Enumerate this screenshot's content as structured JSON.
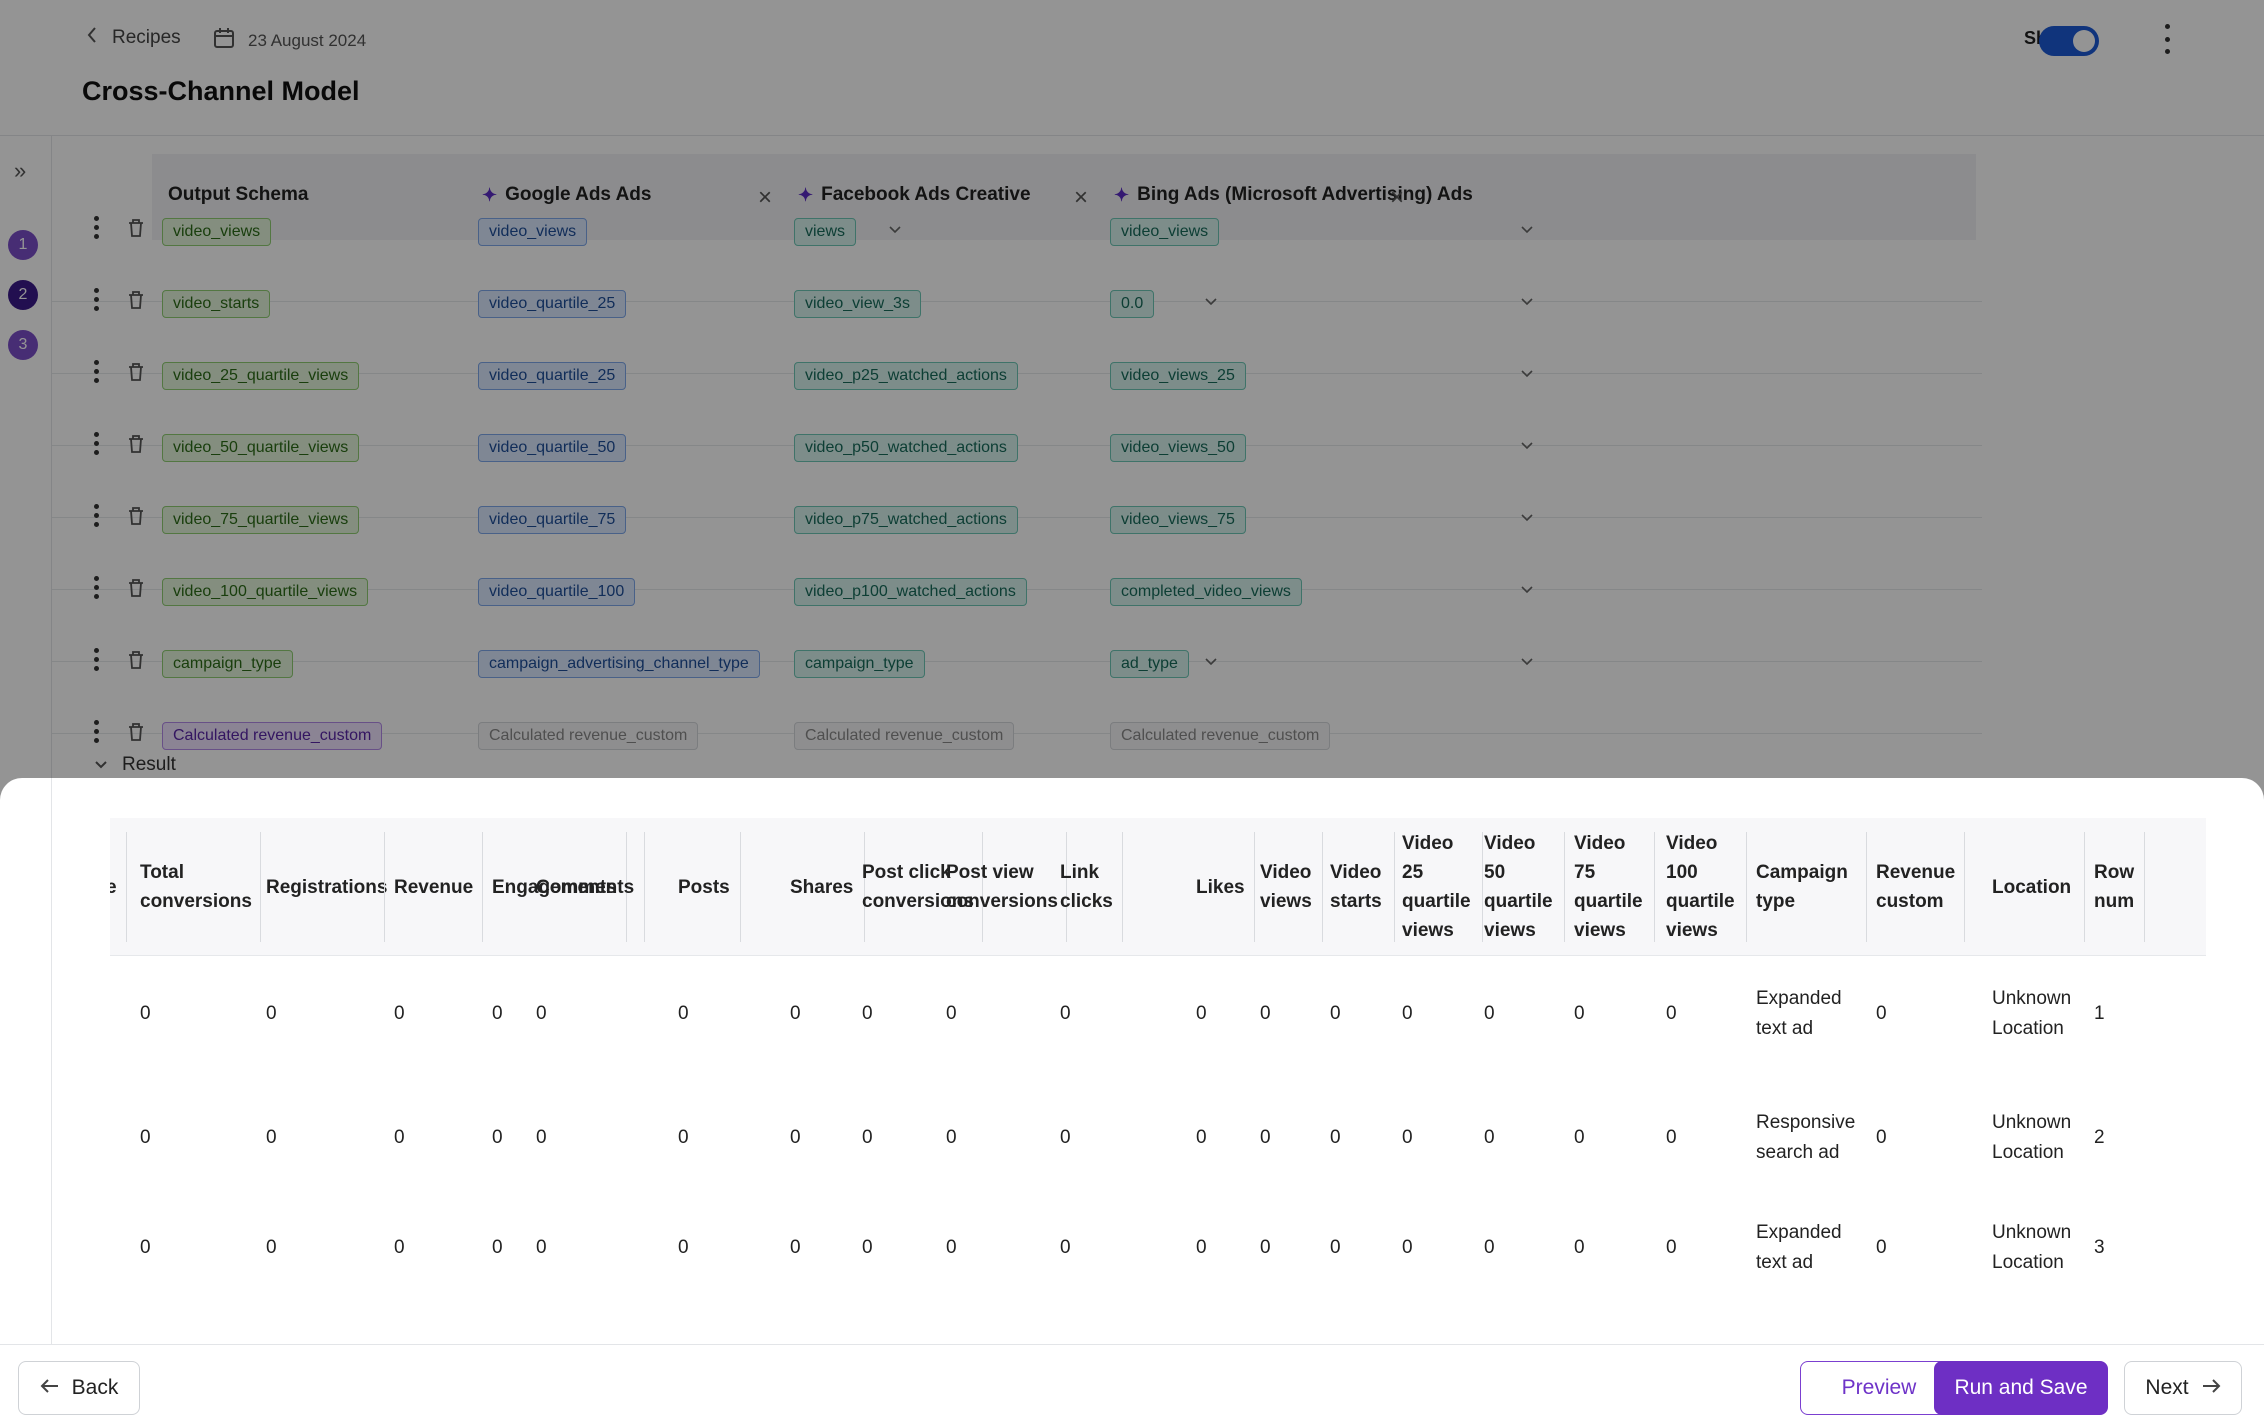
{
  "header": {
    "back_label": "Recipes",
    "date": "23 August 2024",
    "title": "Cross-Channel Model",
    "share_label": "Share",
    "share_enabled": true
  },
  "steps": [
    "1",
    "2",
    "3"
  ],
  "mapping": {
    "columns": [
      {
        "label": "Output Schema"
      },
      {
        "label": "Google Ads Ads"
      },
      {
        "label": "Facebook Ads Creative"
      },
      {
        "label": "Bing Ads (Microsoft Advertising) Ads"
      }
    ],
    "rows": [
      {
        "cells": [
          "video_views",
          "video_views",
          "views",
          "video_views"
        ]
      },
      {
        "cells": [
          "video_starts",
          "video_quartile_25",
          "video_view_3s",
          "0.0"
        ]
      },
      {
        "cells": [
          "video_25_quartile_views",
          "video_quartile_25",
          "video_p25_watched_actions",
          "video_views_25"
        ]
      },
      {
        "cells": [
          "video_50_quartile_views",
          "video_quartile_50",
          "video_p50_watched_actions",
          "video_views_50"
        ]
      },
      {
        "cells": [
          "video_75_quartile_views",
          "video_quartile_75",
          "video_p75_watched_actions",
          "video_views_75"
        ]
      },
      {
        "cells": [
          "video_100_quartile_views",
          "video_quartile_100",
          "video_p100_watched_actions",
          "completed_video_views"
        ]
      },
      {
        "cells": [
          "campaign_type",
          "campaign_advertising_channel_type",
          "campaign_type",
          "ad_type"
        ]
      },
      {
        "cells": [
          "Calculated revenue_custom",
          "Calculated revenue_custom",
          "Calculated revenue_custom",
          "Calculated revenue_custom"
        ]
      }
    ]
  },
  "result_label": "Result",
  "results": {
    "partial_first_header": "e",
    "columns": [
      "Total conversions",
      "Registrations",
      "Revenue",
      "Engagements",
      "Comments",
      "Posts",
      "Shares",
      "Post click conversions",
      "Post view conversions",
      "Link clicks",
      "Likes",
      "Video views",
      "Video starts",
      "Video 25 quartile views",
      "Video 50 quartile views",
      "Video 75 quartile views",
      "Video 100 quartile views",
      "Campaign type",
      "Revenue custom",
      "Location",
      "Row num"
    ],
    "rows": [
      [
        "0",
        "0",
        "0",
        "0",
        "0",
        "0",
        "0",
        "0",
        "0",
        "0",
        "0",
        "0",
        "0",
        "0",
        "0",
        "0",
        "0",
        "Expanded text ad",
        "0",
        "Unknown Location",
        "1"
      ],
      [
        "0",
        "0",
        "0",
        "0",
        "0",
        "0",
        "0",
        "0",
        "0",
        "0",
        "0",
        "0",
        "0",
        "0",
        "0",
        "0",
        "0",
        "Responsive search ad",
        "0",
        "Unknown Location",
        "2"
      ],
      [
        "0",
        "0",
        "0",
        "0",
        "0",
        "0",
        "0",
        "0",
        "0",
        "0",
        "0",
        "0",
        "0",
        "0",
        "0",
        "0",
        "0",
        "Expanded text ad",
        "0",
        "Unknown Location",
        "3"
      ]
    ]
  },
  "footer": {
    "back_label": "Back",
    "preview_label": "Preview",
    "run_label": "Run and Save",
    "next_label": "Next"
  },
  "colors": {
    "accent": "#6e2fc4",
    "toggle": "#1d5bd6",
    "step_active": "#3b1a8a",
    "step_inactive": "#7a4fc9"
  }
}
